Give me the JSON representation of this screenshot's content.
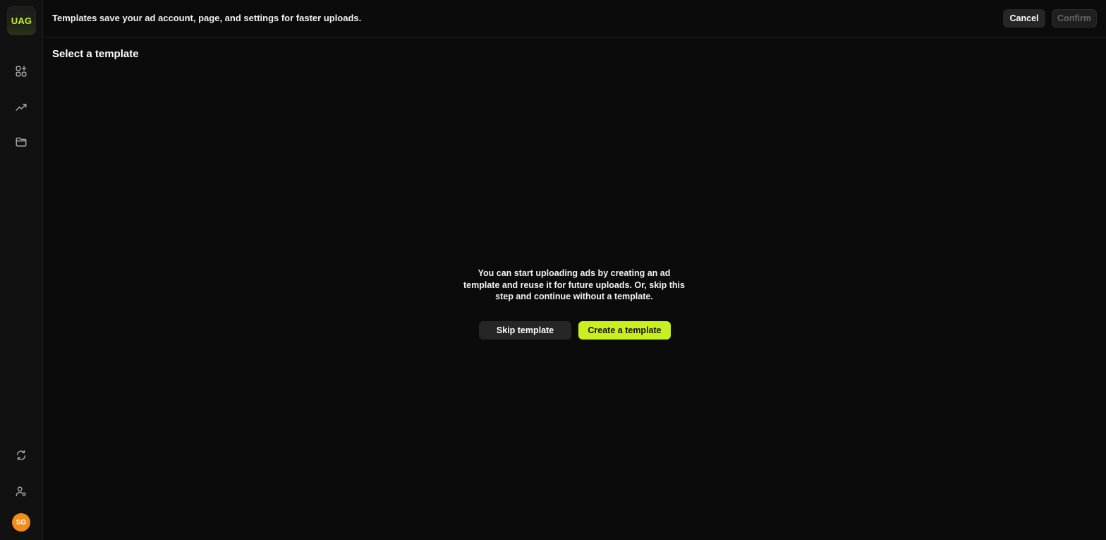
{
  "sidebar": {
    "logo_text": "UAG",
    "nav_icons": [
      "apps-add-icon",
      "trending-up-icon",
      "folder-icon"
    ],
    "bottom_icons": [
      "refresh-cycle-icon",
      "user-settings-icon"
    ],
    "avatar_initials": "SG",
    "colors": {
      "accent": "#c9ef1e",
      "avatar": "#f28c1c"
    }
  },
  "topbar": {
    "message": "Templates save your ad account, page, and settings for faster uploads.",
    "cancel_label": "Cancel",
    "confirm_label": "Confirm"
  },
  "main": {
    "title": "Select a template",
    "empty_state": {
      "message": "You can start uploading ads by creating an ad template and reuse it for future uploads. Or, skip this step and continue without a template.",
      "skip_label": "Skip template",
      "create_label": "Create a template"
    }
  }
}
